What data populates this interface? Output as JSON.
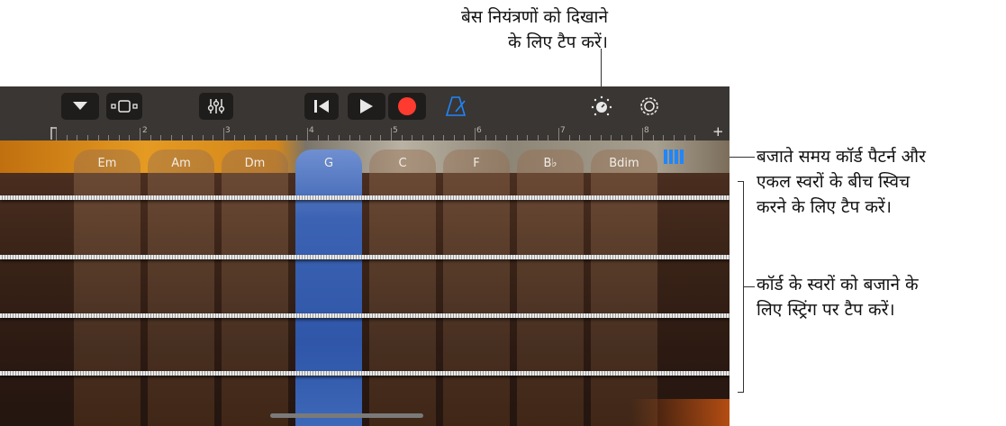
{
  "callouts": {
    "top_line1": "बेस नियंत्रणों को दिखाने",
    "top_line2": "के लिए टैप करें।",
    "right1_line1": "बजाते समय कॉर्ड पैटर्न और",
    "right1_line2": "एकल स्वरों के बीच स्विच",
    "right1_line3": "करने के लिए टैप करें।",
    "right2_line1": "कॉर्ड के स्वरों को बजाने के",
    "right2_line2": "लिए स्ट्रिंग पर टैप करें।"
  },
  "ruler": {
    "bars": [
      "2",
      "3",
      "4",
      "5",
      "6",
      "7",
      "8"
    ],
    "plus": "+"
  },
  "chords": [
    "Em",
    "Am",
    "Dm",
    "G",
    "C",
    "F",
    "B♭",
    "Bdim"
  ],
  "active_chord": "G",
  "colors": {
    "accent": "#1f86ff",
    "record": "#ff3b30",
    "active_column": "#2f56a8"
  },
  "icons": {
    "toolbar": [
      "tracks-dropdown-icon",
      "browser-icon",
      "mixer-icon",
      "rewind-icon",
      "play-icon",
      "record-icon",
      "metronome-icon",
      "bass-controls-knob-icon",
      "settings-gear-icon"
    ],
    "pattern": "chord-pattern-toggle-icon"
  }
}
